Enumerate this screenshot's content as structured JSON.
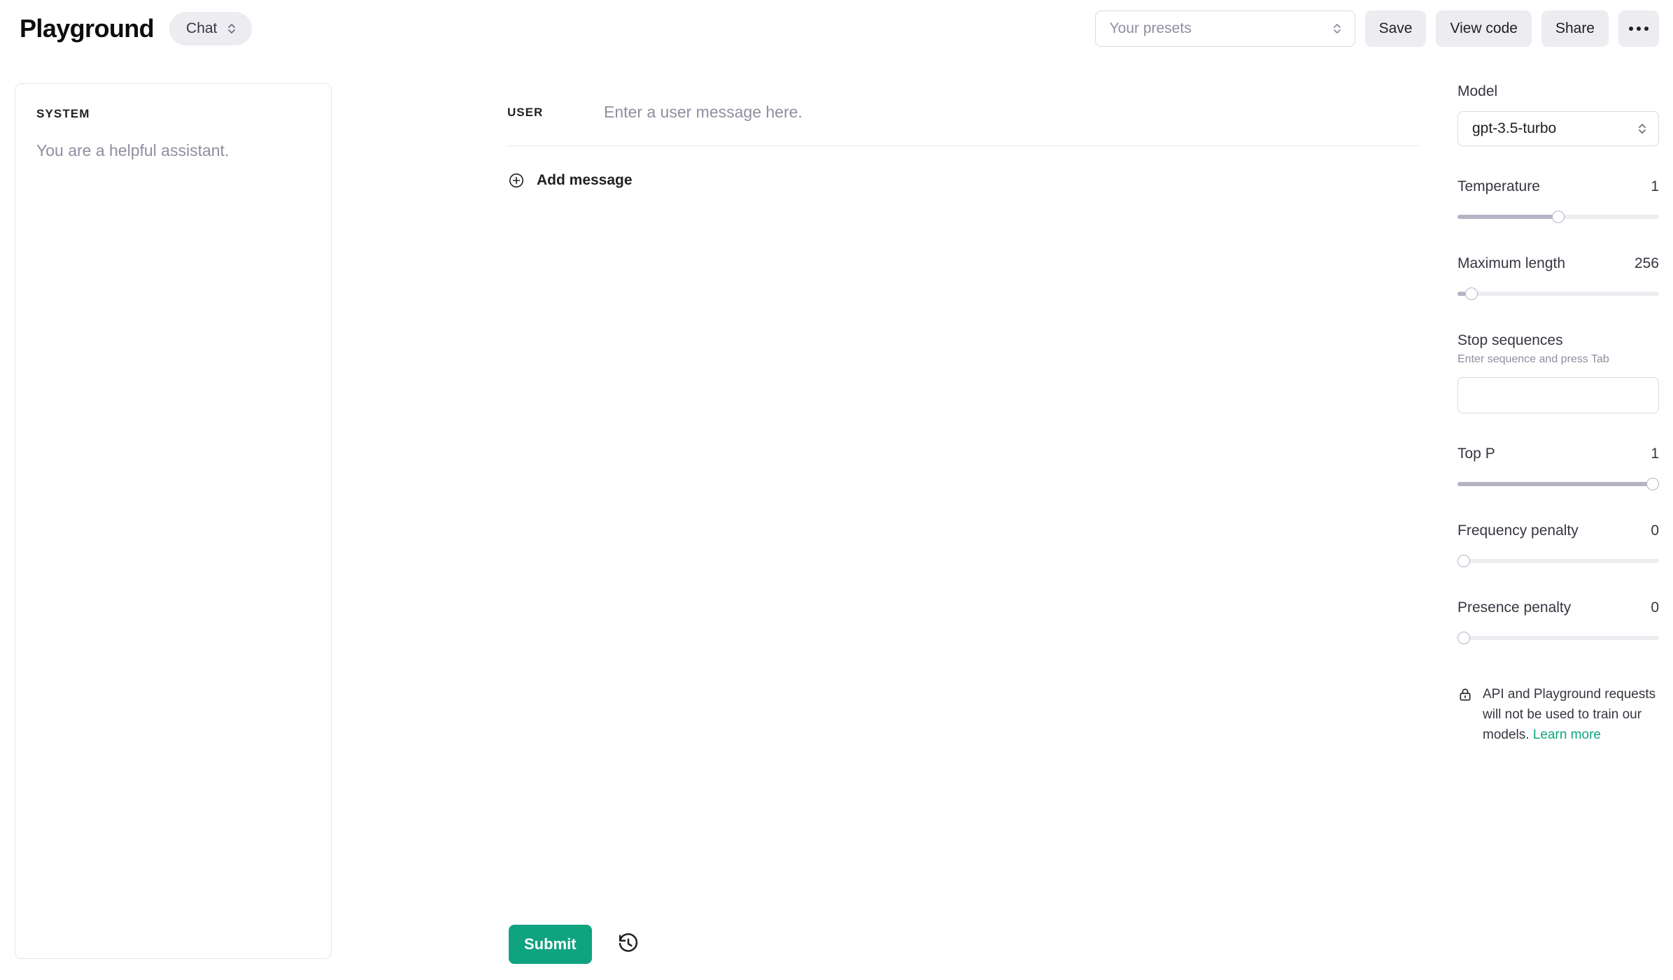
{
  "header": {
    "brand": "Playground",
    "mode": {
      "label": "Chat",
      "icon": "chevron-updown-icon"
    },
    "presets": {
      "placeholder": "Your presets",
      "value": "",
      "icon": "chevron-updown-icon"
    },
    "buttons": [
      {
        "id": "save",
        "label": "Save"
      },
      {
        "id": "view-code",
        "label": "View code"
      },
      {
        "id": "share",
        "label": "Share"
      }
    ],
    "more": {
      "label": "•••",
      "icon": "ellipsis-icon"
    }
  },
  "system": {
    "title": "SYSTEM",
    "placeholder": "You are a helpful assistant.",
    "value": ""
  },
  "conversation": {
    "messages": [
      {
        "role": "USER",
        "placeholder": "Enter a user message here.",
        "value": ""
      }
    ],
    "add_message": {
      "label": "Add message",
      "icon": "plus-circle-icon"
    }
  },
  "actions": {
    "submit": {
      "label": "Submit",
      "color": "#10a37f"
    },
    "history": {
      "icon": "history-clock-icon",
      "label": ""
    }
  },
  "sidebar": {
    "model": {
      "label": "Model",
      "value": "gpt-3.5-turbo",
      "icon": "chevron-updown-icon"
    },
    "parameters": [
      {
        "id": "temperature",
        "label": "Temperature",
        "value": "1",
        "percent": 50
      },
      {
        "id": "maximum-length",
        "label": "Maximum length",
        "value": "256",
        "percent": 4
      },
      {
        "id": "top-p",
        "label": "Top P",
        "value": "1",
        "percent": 100
      },
      {
        "id": "frequency-penalty",
        "label": "Frequency penalty",
        "value": "0",
        "percent": 0
      },
      {
        "id": "presence-penalty",
        "label": "Presence penalty",
        "value": "0",
        "percent": 0
      }
    ],
    "stop_sequences": {
      "label": "Stop sequences",
      "hint": "Enter sequence and press Tab",
      "value": "",
      "placeholder": ""
    },
    "privacy": {
      "icon": "lock-icon",
      "text": "API and Playground requests will not be used to train our models. ",
      "link_label": "Learn more",
      "link_color": "#10a37f"
    }
  }
}
